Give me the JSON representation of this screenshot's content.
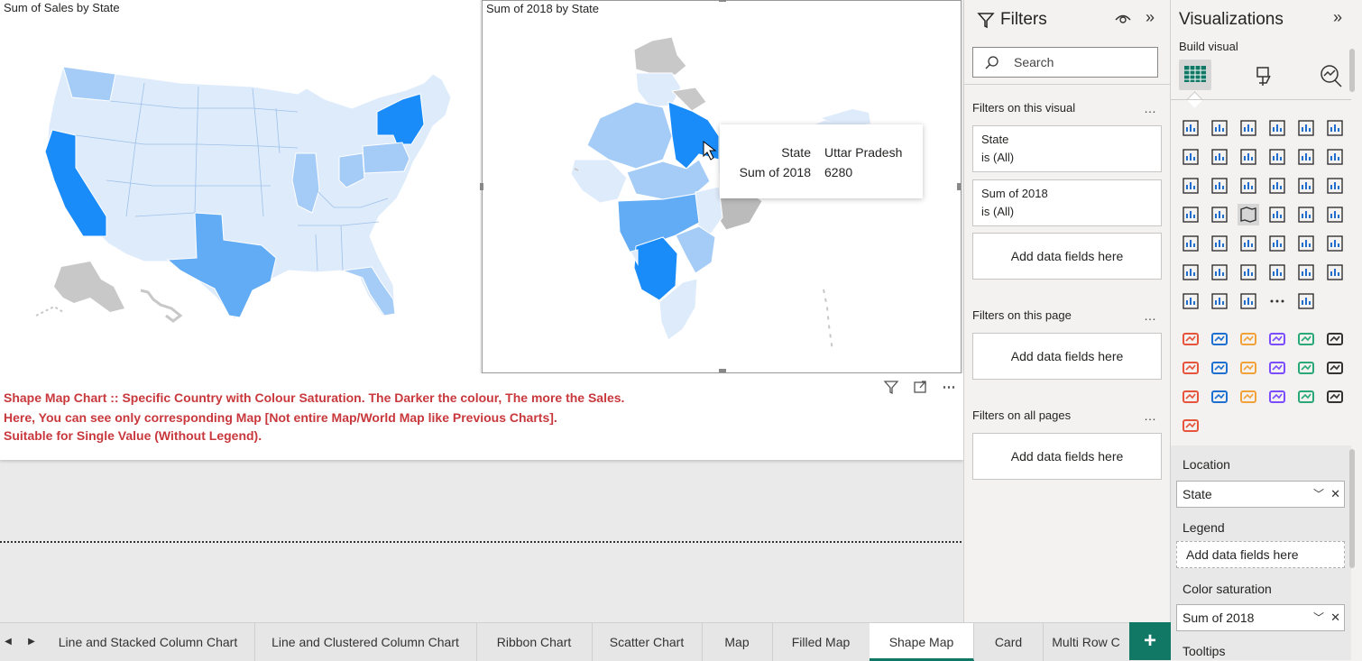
{
  "canvas": {
    "visual1": {
      "title": "Sum of Sales by State"
    },
    "visual2": {
      "title": "Sum of 2018 by State",
      "tooltip": {
        "rows": [
          {
            "label": "State",
            "value": "Uttar Pradesh"
          },
          {
            "label": "Sum of 2018",
            "value": "6280"
          }
        ]
      }
    },
    "description": [
      "Shape Map Chart :: Specific Country with Colour Saturation. The Darker the colour, The more the Sales.",
      "Here, You can see only corresponding Map [Not entire Map/World Map like Previous Charts].",
      "Suitable for Single Value (Without Legend)."
    ],
    "colors": {
      "light": "#deebfb",
      "medium": "#a5ccf7",
      "strong": "#62acf6",
      "dark": "#1a8cfa",
      "nodata": "#c8c8c8",
      "desc_text": "#c8383c"
    }
  },
  "filters": {
    "title": "Filters",
    "search_placeholder": "Search",
    "sections": {
      "visual": {
        "label": "Filters on this visual",
        "cards": [
          {
            "name": "State",
            "cond": "is (All)"
          },
          {
            "name": "Sum of 2018",
            "cond": "is (All)"
          }
        ],
        "drop": "Add data fields here"
      },
      "page": {
        "label": "Filters on this page",
        "drop": "Add data fields here"
      },
      "all": {
        "label": "Filters on all pages",
        "drop": "Add data fields here"
      }
    }
  },
  "viz": {
    "title": "Visualizations",
    "build_visual": "Build visual",
    "wells": {
      "location": {
        "label": "Location",
        "field": "State"
      },
      "legend": {
        "label": "Legend",
        "placeholder": "Add data fields here"
      },
      "color": {
        "label": "Color saturation",
        "field": "Sum of 2018"
      },
      "tooltips": {
        "label": "Tooltips"
      }
    }
  },
  "tabs": [
    "Line and Stacked Column Chart",
    "Line and Clustered Column Chart",
    "Ribbon Chart",
    "Scatter Chart",
    "Map",
    "Filled Map",
    "Shape Map",
    "Card",
    "Multi Row C"
  ],
  "active_tab": "Shape Map",
  "accent": "#117865"
}
